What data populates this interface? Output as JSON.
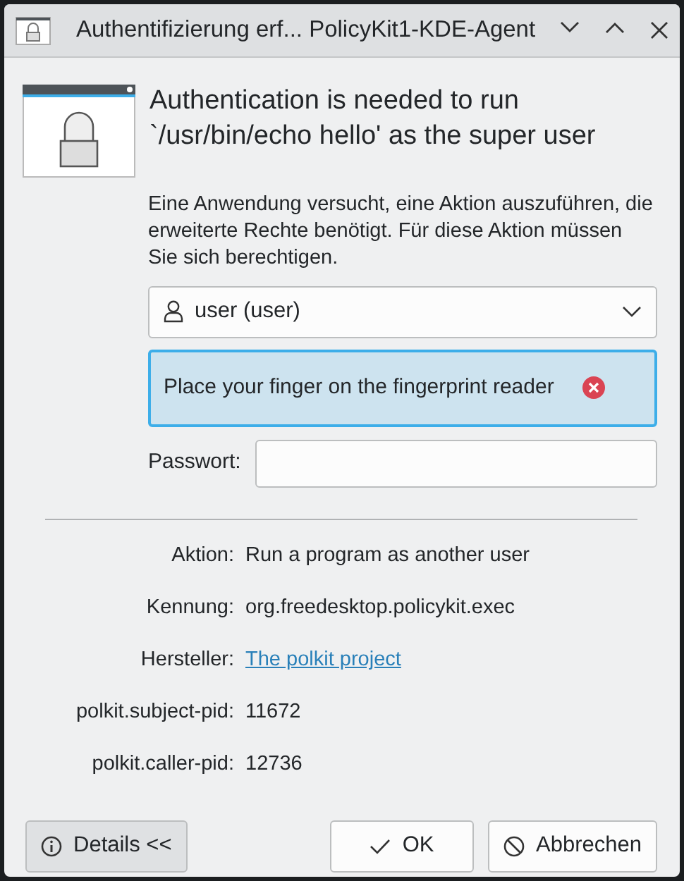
{
  "window": {
    "title": "Authentifizierung erf... PolicyKit1-KDE-Agent"
  },
  "heading": "Authentication is needed to run `/usr/bin/echo hello' as the super user",
  "description": "Eine Anwendung versucht, eine Aktion auszuführen, die erweiterte Rechte benötigt. Für diese Aktion müssen Sie sich berechtigen.",
  "user_select": {
    "value": "user (user)"
  },
  "fingerprint_message": "Place your finger on the fingerprint reader",
  "password": {
    "label": "Passwort:"
  },
  "details": [
    {
      "label": "Aktion:",
      "value": "Run a program as another user",
      "kind": "text"
    },
    {
      "label": "Kennung:",
      "value": "org.freedesktop.policykit.exec",
      "kind": "text"
    },
    {
      "label": "Hersteller:",
      "value": "The polkit project",
      "kind": "link"
    },
    {
      "label": "polkit.subject-pid:",
      "value": "11672",
      "kind": "text"
    },
    {
      "label": "polkit.caller-pid:",
      "value": "12736",
      "kind": "text"
    }
  ],
  "buttons": {
    "details": {
      "label": "Details <<",
      "pressed": true
    },
    "ok": "OK",
    "cancel": "Abbrechen"
  }
}
